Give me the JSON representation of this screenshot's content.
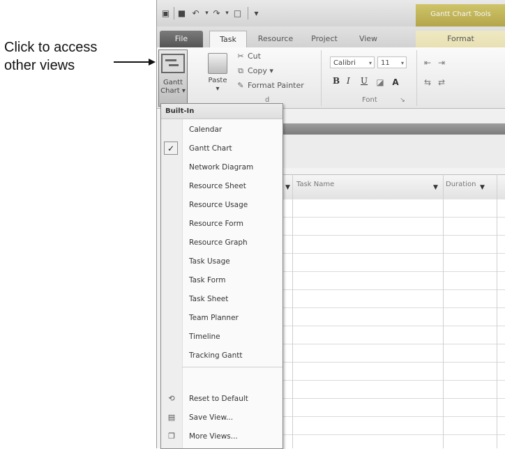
{
  "annotation": {
    "line1": "Click to access",
    "line2": "other views"
  },
  "qat": {
    "customize_glyph": "▾"
  },
  "contextual_tab": {
    "label": "Gantt Chart Tools"
  },
  "tabs": {
    "file": "File",
    "task": "Task",
    "resource": "Resource",
    "project": "Project",
    "view": "View",
    "format": "Format"
  },
  "ribbon": {
    "gantt_label_1": "Gantt",
    "gantt_label_2": "Chart ▾",
    "paste_label": "Paste",
    "paste_arrow": "▾",
    "cut": "Cut",
    "copy": "Copy ▾",
    "format_painter": "Format Painter",
    "clipboard_group": "d",
    "font_name": "Calibri",
    "font_size": "11",
    "bold": "B",
    "italic": "I",
    "underline": "U",
    "font_group": "Font"
  },
  "grid": {
    "col_task_name": "Task Name",
    "col_duration": "Duration"
  },
  "menu": {
    "header": "Built-In",
    "items": [
      {
        "label": "Calendar",
        "checked": false
      },
      {
        "label": "Gantt Chart",
        "checked": true
      },
      {
        "label": "Network Diagram",
        "checked": false
      },
      {
        "label": "Resource Sheet",
        "checked": false
      },
      {
        "label": "Resource Usage",
        "checked": false
      },
      {
        "label": "Resource Form",
        "checked": false
      },
      {
        "label": "Resource Graph",
        "checked": false
      },
      {
        "label": "Task Usage",
        "checked": false
      },
      {
        "label": "Task Form",
        "checked": false
      },
      {
        "label": "Task Sheet",
        "checked": false
      },
      {
        "label": "Team Planner",
        "checked": false
      },
      {
        "label": "Timeline",
        "checked": false
      },
      {
        "label": "Tracking Gantt",
        "checked": false
      }
    ],
    "actions": [
      {
        "label": "Reset to Default",
        "icon": "reset-icon"
      },
      {
        "label": "Save View...",
        "icon": "save-view-icon"
      },
      {
        "label": "More Views...",
        "icon": "more-views-icon"
      }
    ],
    "check_glyph": "✓"
  }
}
